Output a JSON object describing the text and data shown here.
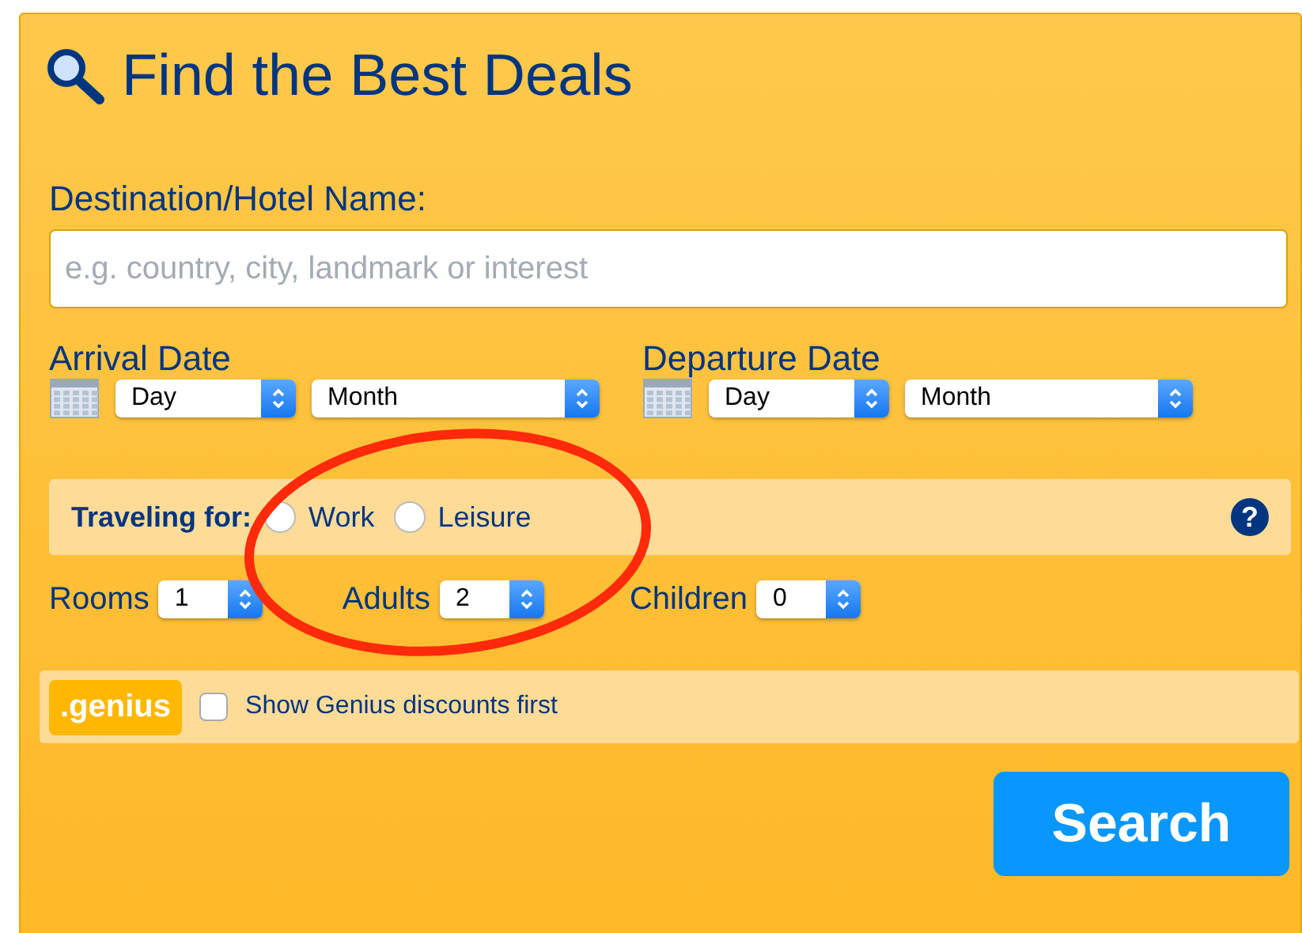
{
  "title": "Find the Best Deals",
  "destination": {
    "label": "Destination/Hotel Name:",
    "placeholder": "e.g. country, city, landmark or interest"
  },
  "dates": [
    {
      "label": "Arrival Date",
      "day": "Day",
      "month": "Month"
    },
    {
      "label": "Departure Date",
      "day": "Day",
      "month": "Month"
    }
  ],
  "traveling": {
    "label": "Traveling for:",
    "options": [
      {
        "label": "Work",
        "selected": false
      },
      {
        "label": "Leisure",
        "selected": false
      }
    ],
    "help": "?"
  },
  "occupancy": [
    {
      "label": "Rooms",
      "value": "1"
    },
    {
      "label": "Adults",
      "value": "2"
    },
    {
      "label": "Children",
      "value": "0"
    }
  ],
  "genius": {
    "badge": ".genius",
    "label": "Show Genius discounts first",
    "checked": false
  },
  "search_button": "Search"
}
